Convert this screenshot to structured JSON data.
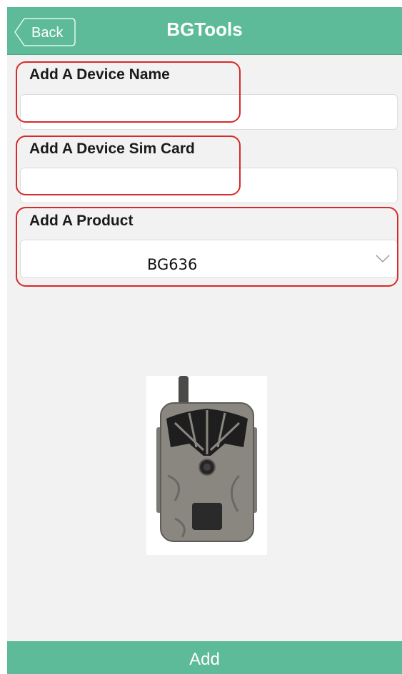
{
  "header": {
    "back_label": "Back",
    "title": "BGTools"
  },
  "form": {
    "device_name_label": "Add A Device Name",
    "device_name_value": "",
    "sim_card_label": "Add A Device Sim Card",
    "sim_card_value": "",
    "product_label": "Add A Product",
    "product_selected": "BG636"
  },
  "footer": {
    "add_label": "Add"
  },
  "colors": {
    "accent": "#5dbb9a",
    "highlight": "#d72a2a"
  },
  "icons": {
    "back": "back-arrow-icon",
    "dropdown": "chevron-down-icon"
  }
}
